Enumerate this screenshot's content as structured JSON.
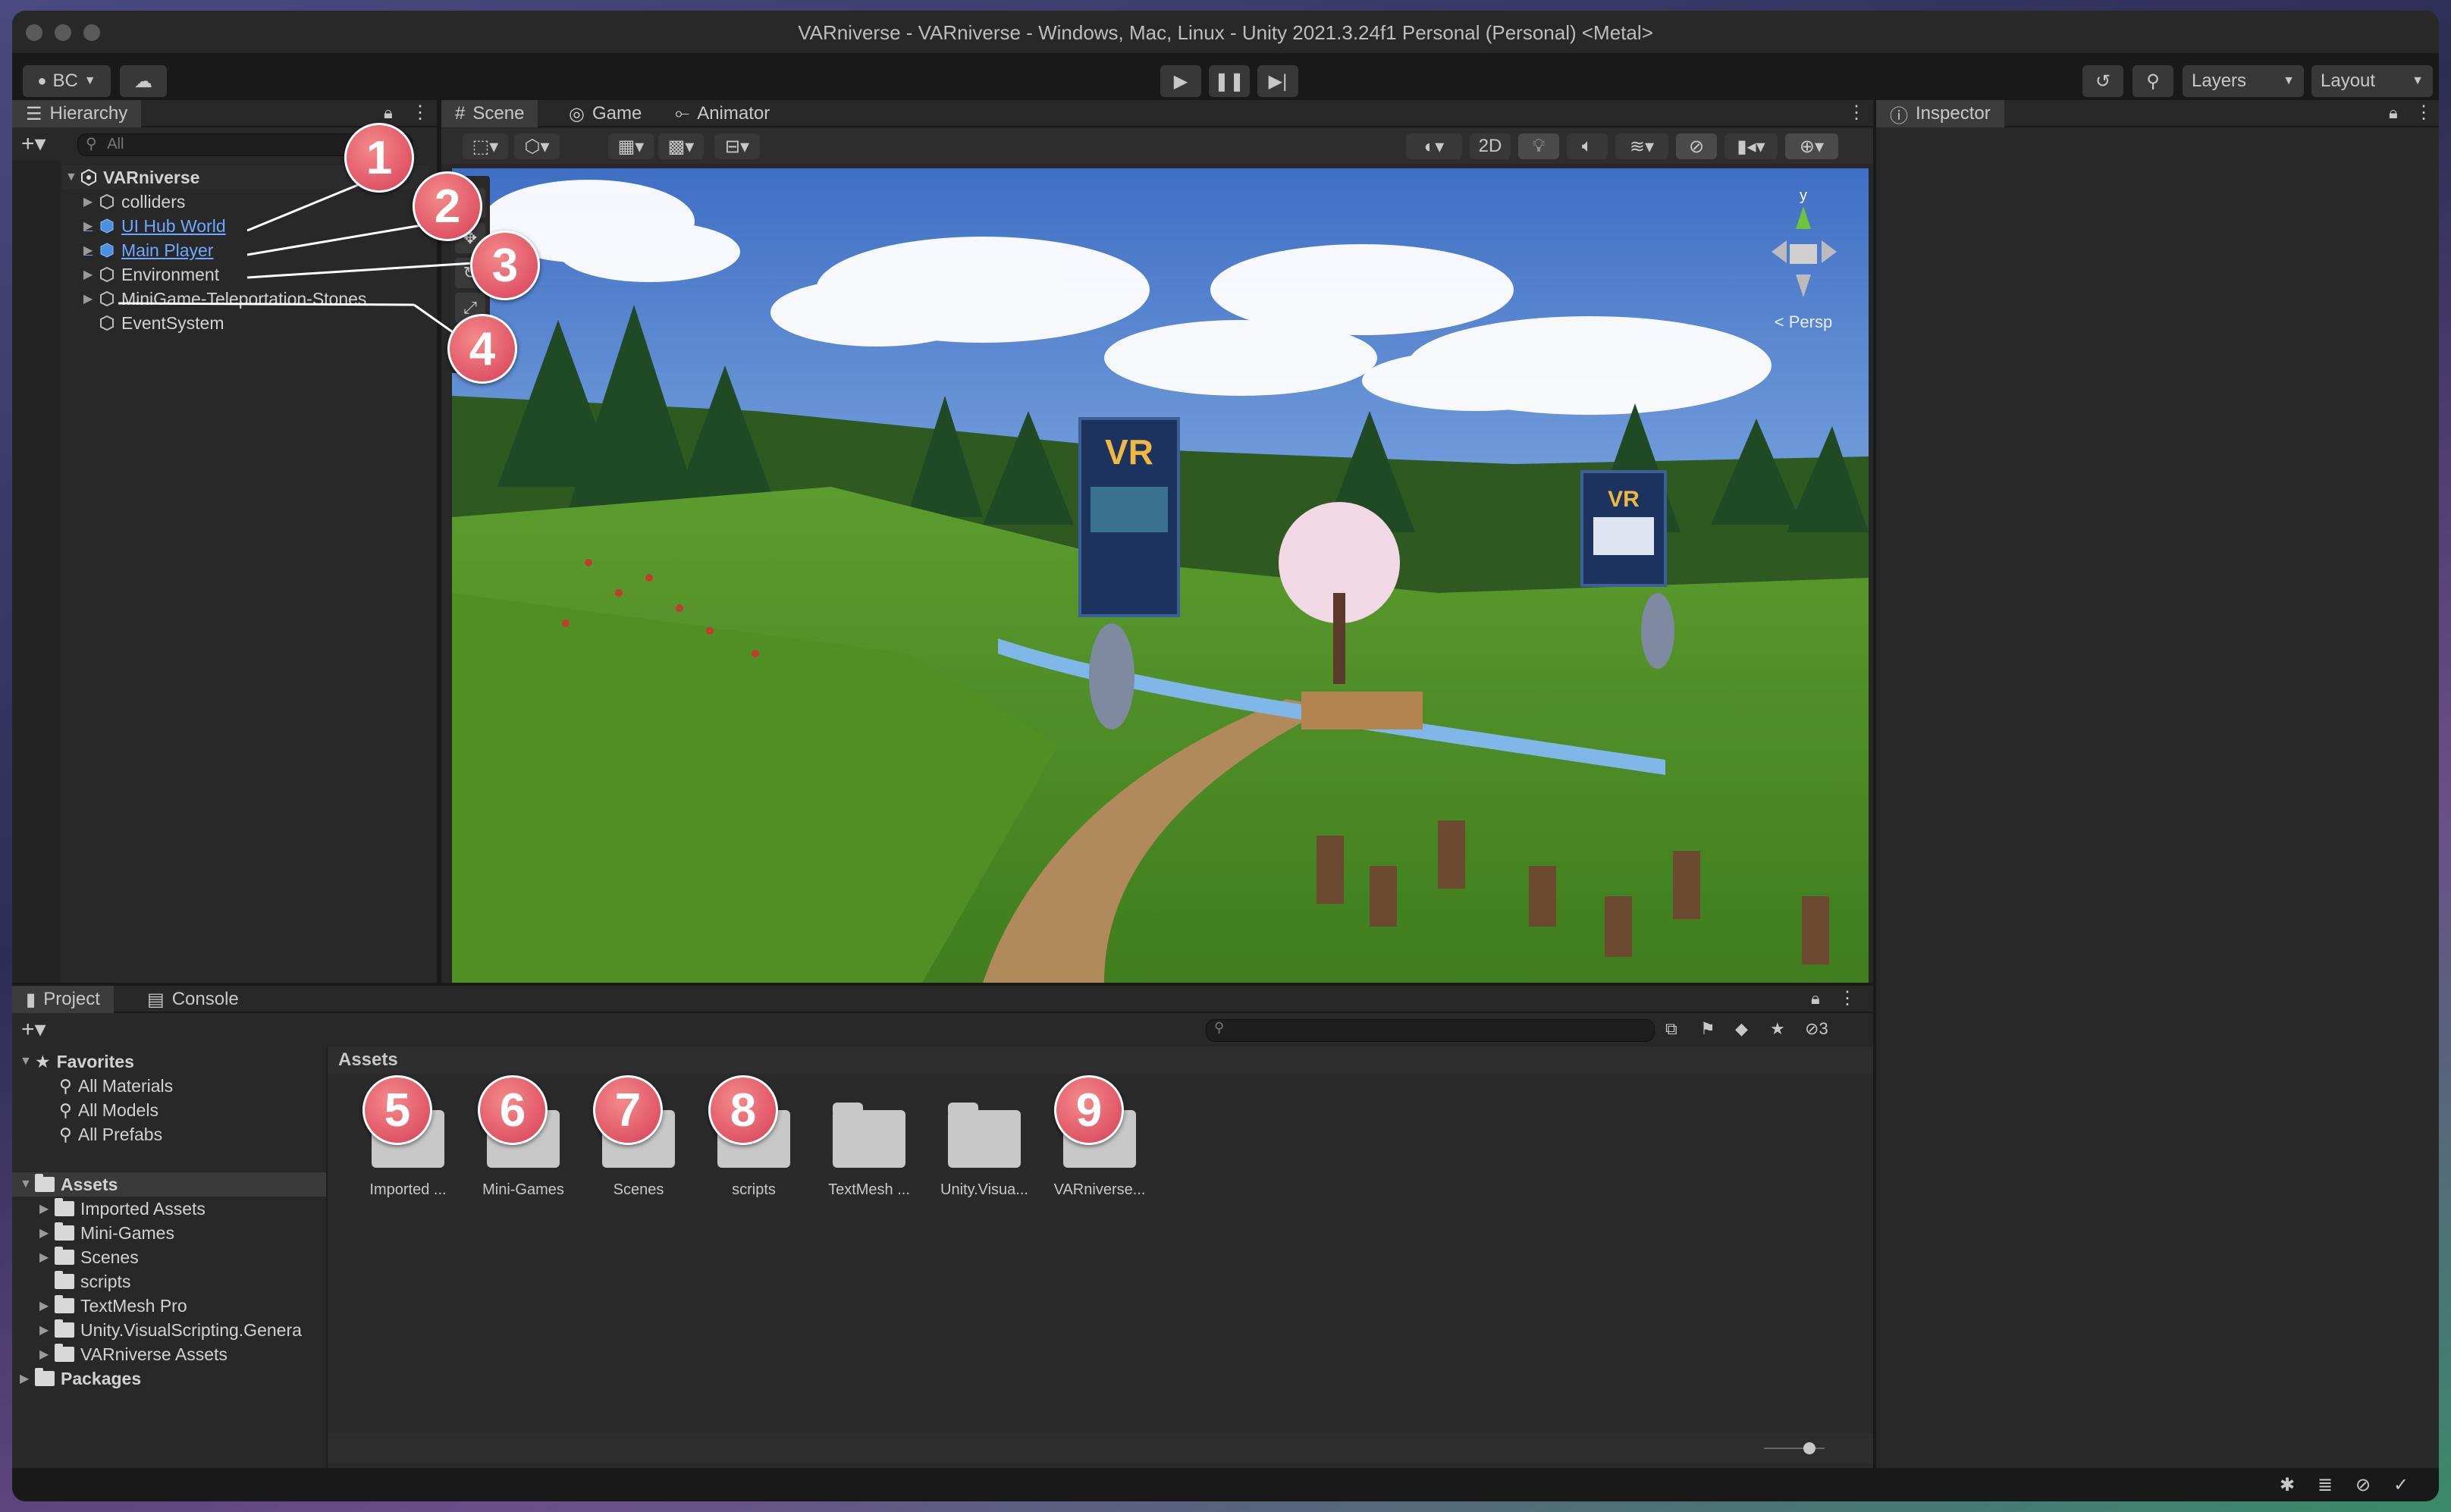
{
  "window": {
    "title": "VARniverse - VARniverse - Windows, Mac, Linux - Unity 2021.3.24f1 Personal (Personal) <Metal>"
  },
  "toolbar": {
    "account_label": "BC",
    "layers_label": "Layers",
    "layout_label": "Layout"
  },
  "hierarchy": {
    "tab_label": "Hierarchy",
    "search_placeholder": "All",
    "root": "VARniverse",
    "items": [
      {
        "label": "colliders"
      },
      {
        "label": "UI Hub World"
      },
      {
        "label": "Main Player"
      },
      {
        "label": "Environment"
      },
      {
        "label": "MiniGame-Teleportation-Stones"
      },
      {
        "label": "EventSystem"
      }
    ]
  },
  "scene": {
    "tabs": [
      {
        "label": "Scene"
      },
      {
        "label": "Game"
      },
      {
        "label": "Animator"
      }
    ],
    "mode_2d": "2D",
    "gizmo_axis": "y",
    "persp_label": "< Persp",
    "sign_text": "VR"
  },
  "inspector": {
    "tab_label": "Inspector"
  },
  "project": {
    "tabs": [
      {
        "label": "Project"
      },
      {
        "label": "Console"
      }
    ],
    "hidden_count": "3",
    "favorites_label": "Favorites",
    "favorites": [
      {
        "label": "All Materials"
      },
      {
        "label": "All Models"
      },
      {
        "label": "All Prefabs"
      }
    ],
    "assets_label": "Assets",
    "asset_folders": [
      {
        "label": "Imported Assets"
      },
      {
        "label": "Mini-Games"
      },
      {
        "label": "Scenes"
      },
      {
        "label": "scripts"
      },
      {
        "label": "TextMesh Pro"
      },
      {
        "label": "Unity.VisualScripting.Genera"
      },
      {
        "label": "VARniverse Assets"
      }
    ],
    "packages_label": "Packages",
    "breadcrumb": "Assets",
    "grid_items": [
      {
        "label": "Imported ..."
      },
      {
        "label": "Mini-Games"
      },
      {
        "label": "Scenes"
      },
      {
        "label": "scripts"
      },
      {
        "label": "TextMesh ..."
      },
      {
        "label": "Unity.Visua..."
      },
      {
        "label": "VARniverse..."
      }
    ]
  },
  "annotations": [
    {
      "label": "1"
    },
    {
      "label": "2"
    },
    {
      "label": "3"
    },
    {
      "label": "4"
    },
    {
      "label": "5"
    },
    {
      "label": "6"
    },
    {
      "label": "7"
    },
    {
      "label": "8"
    },
    {
      "label": "9"
    }
  ],
  "colors": {
    "accent_blue": "#6ea8ff",
    "badge": "#e05566",
    "panel": "#282828"
  }
}
